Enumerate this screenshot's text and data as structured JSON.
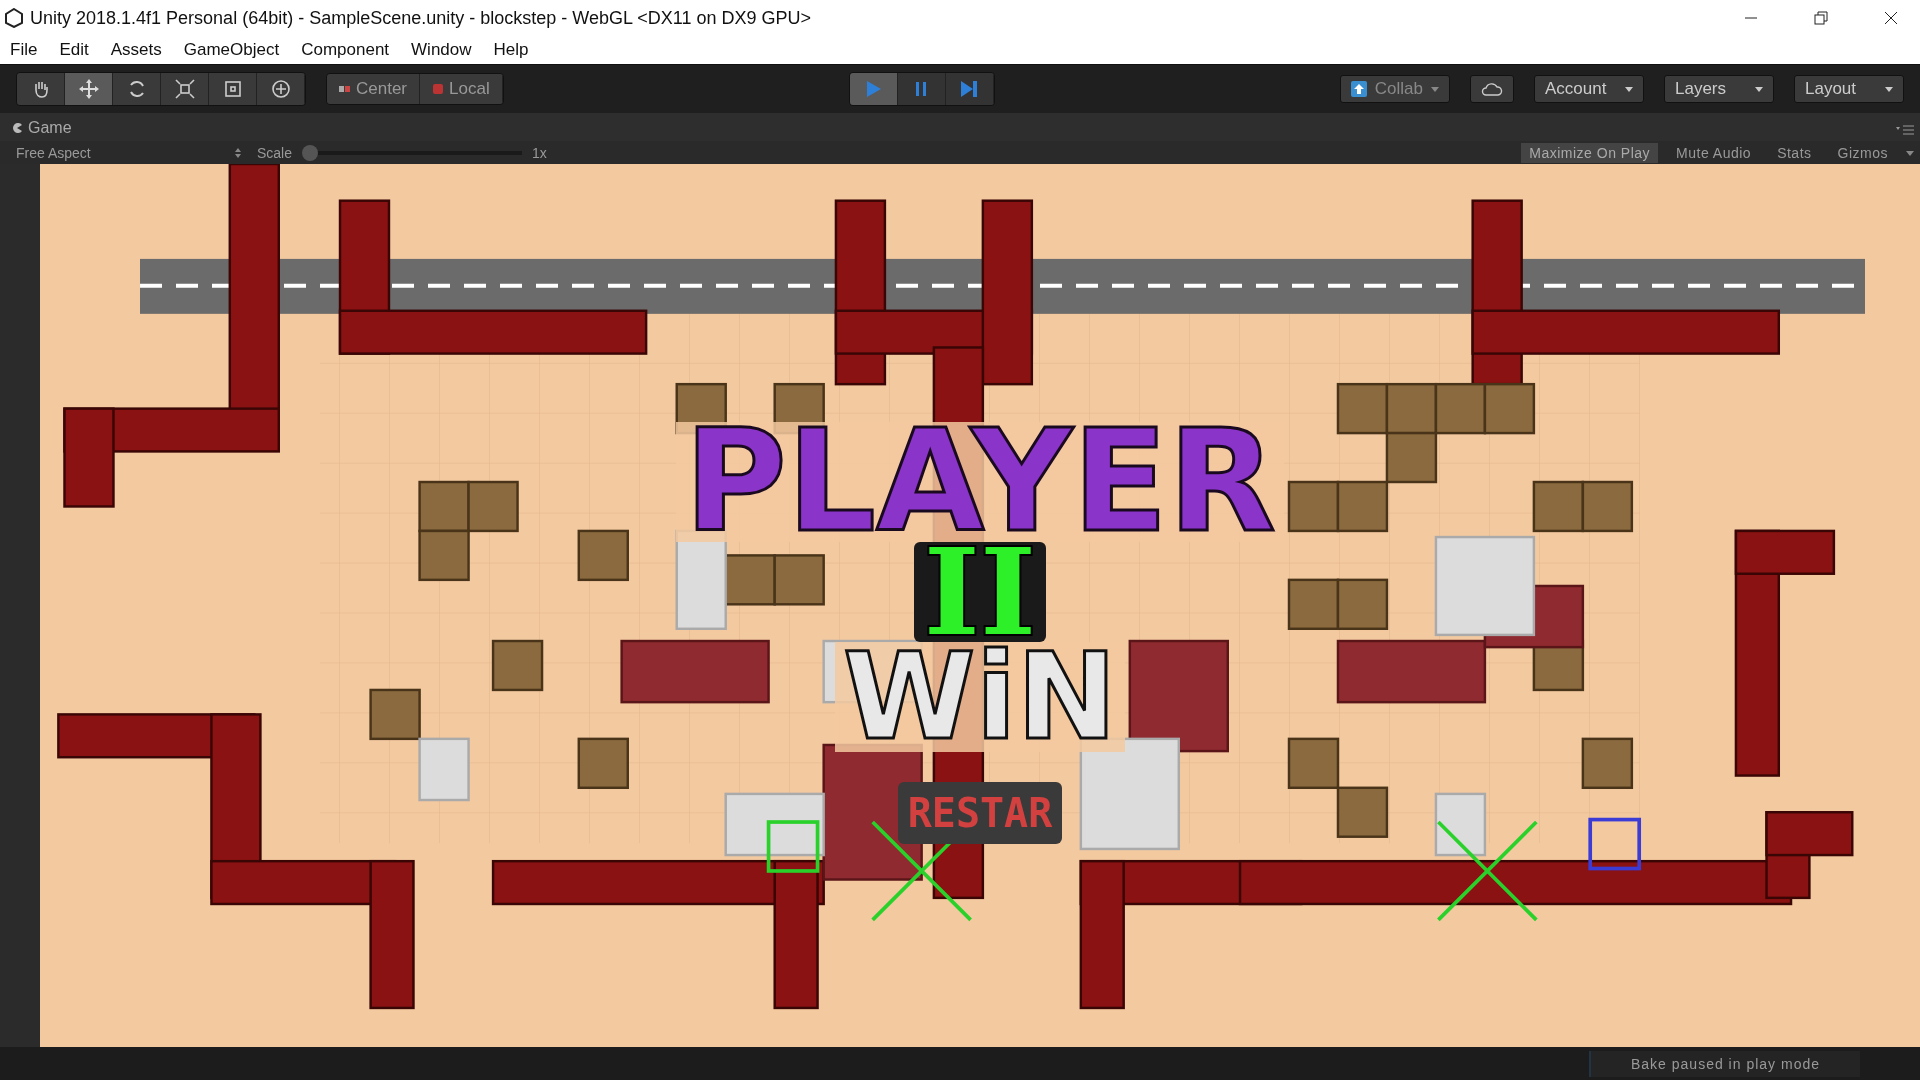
{
  "window": {
    "title": "Unity 2018.1.4f1 Personal (64bit) - SampleScene.unity - blockstep - WebGL <DX11 on DX9 GPU>"
  },
  "menu": [
    "File",
    "Edit",
    "Assets",
    "GameObject",
    "Component",
    "Window",
    "Help"
  ],
  "tools": [
    {
      "kind": "hand",
      "selected": false
    },
    {
      "kind": "move",
      "selected": true
    },
    {
      "kind": "rotate",
      "selected": false
    },
    {
      "kind": "scale",
      "selected": false
    },
    {
      "kind": "rect",
      "selected": false
    },
    {
      "kind": "transform",
      "selected": false
    }
  ],
  "pivot": [
    "Center",
    "Local"
  ],
  "play_controls": [
    {
      "kind": "play",
      "on": true
    },
    {
      "kind": "pause",
      "on": false
    },
    {
      "kind": "step",
      "on": false
    }
  ],
  "right_toolbar": {
    "collab": "Collab",
    "account": "Account",
    "layers": "Layers",
    "layout": "Layout"
  },
  "game_tab": {
    "title": "Game",
    "aspect": "Free Aspect",
    "scale_label": "Scale",
    "scale_value": "1x",
    "level": 0,
    "toggles": [
      {
        "label": "Maximize On Play",
        "on": true
      },
      {
        "label": "Mute Audio",
        "on": false
      },
      {
        "label": "Stats",
        "on": false
      },
      {
        "label": "Gizmos",
        "on": false
      }
    ]
  },
  "game": {
    "headline": "PLAYER",
    "player": "II",
    "result": "WiN",
    "restart": "RESTAR"
  },
  "status_bar": {
    "message": "Bake paused in play mode"
  }
}
